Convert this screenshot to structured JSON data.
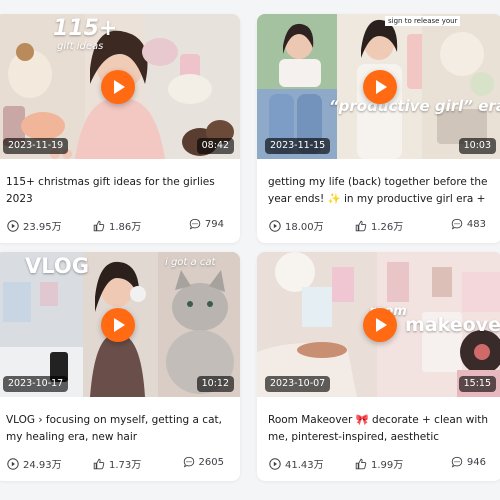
{
  "videos": [
    {
      "date": "2023-11-19",
      "duration": "08:42",
      "title": "115+ christmas gift ideas for the girlies 2023",
      "views": "23.95万",
      "likes": "1.86万",
      "comments": "794",
      "overlay": [
        "115+",
        "gift ideas"
      ]
    },
    {
      "date": "2023-11-15",
      "duration": "10:03",
      "title": "getting my life (back) together before the year ends! ✨ in my productive girl era + cozy autumn days",
      "views": "18.00万",
      "likes": "1.26万",
      "comments": "483",
      "overlay": [
        "“productive girl” era",
        "sign to release your"
      ]
    },
    {
      "date": "2023-10-17",
      "duration": "10:12",
      "title": "VLOG › focusing on myself, getting a cat, my healing era, new hair",
      "views": "24.93万",
      "likes": "1.73万",
      "comments": "2605",
      "overlay": [
        "VLOG",
        "i got a cat"
      ]
    },
    {
      "date": "2023-10-07",
      "duration": "15:15",
      "title": "Room Makeover 🎀 decorate + clean with me, pinterest-inspired, aesthetic transformation",
      "views": "41.43万",
      "likes": "1.99万",
      "comments": "946",
      "overlay": [
        "room",
        "makeover"
      ]
    }
  ],
  "colors": {
    "accent": "#ff6a13",
    "background": "#f4f5f7",
    "card": "#ffffff"
  },
  "icons": {
    "views": "play-circle-icon",
    "likes": "thumbs-up-icon",
    "comments": "chat-bubble-icon"
  }
}
